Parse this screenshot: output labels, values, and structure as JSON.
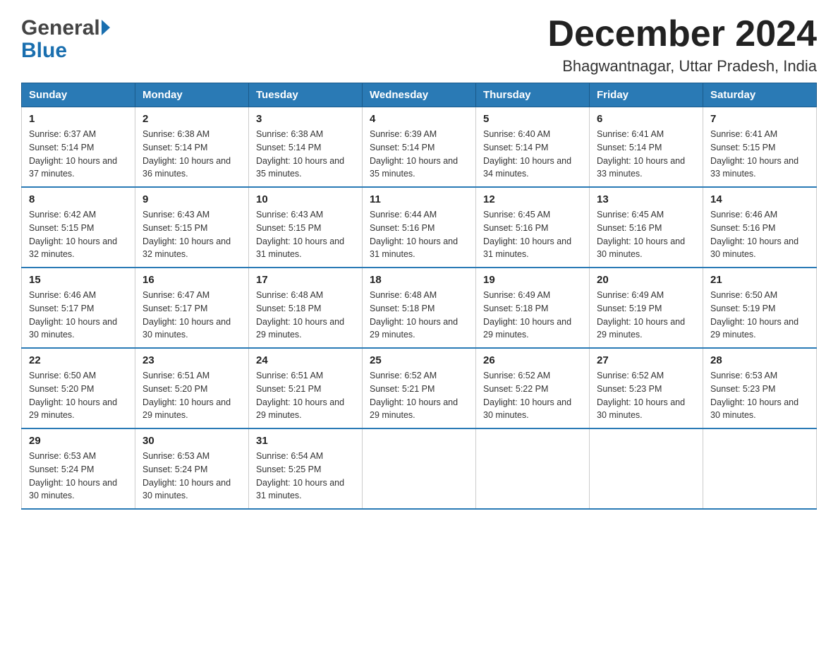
{
  "header": {
    "logo_general": "General",
    "logo_blue": "Blue",
    "month_title": "December 2024",
    "location": "Bhagwantnagar, Uttar Pradesh, India"
  },
  "days_of_week": [
    "Sunday",
    "Monday",
    "Tuesday",
    "Wednesday",
    "Thursday",
    "Friday",
    "Saturday"
  ],
  "weeks": [
    [
      {
        "day": "1",
        "sunrise": "6:37 AM",
        "sunset": "5:14 PM",
        "daylight": "10 hours and 37 minutes."
      },
      {
        "day": "2",
        "sunrise": "6:38 AM",
        "sunset": "5:14 PM",
        "daylight": "10 hours and 36 minutes."
      },
      {
        "day": "3",
        "sunrise": "6:38 AM",
        "sunset": "5:14 PM",
        "daylight": "10 hours and 35 minutes."
      },
      {
        "day": "4",
        "sunrise": "6:39 AM",
        "sunset": "5:14 PM",
        "daylight": "10 hours and 35 minutes."
      },
      {
        "day": "5",
        "sunrise": "6:40 AM",
        "sunset": "5:14 PM",
        "daylight": "10 hours and 34 minutes."
      },
      {
        "day": "6",
        "sunrise": "6:41 AM",
        "sunset": "5:14 PM",
        "daylight": "10 hours and 33 minutes."
      },
      {
        "day": "7",
        "sunrise": "6:41 AM",
        "sunset": "5:15 PM",
        "daylight": "10 hours and 33 minutes."
      }
    ],
    [
      {
        "day": "8",
        "sunrise": "6:42 AM",
        "sunset": "5:15 PM",
        "daylight": "10 hours and 32 minutes."
      },
      {
        "day": "9",
        "sunrise": "6:43 AM",
        "sunset": "5:15 PM",
        "daylight": "10 hours and 32 minutes."
      },
      {
        "day": "10",
        "sunrise": "6:43 AM",
        "sunset": "5:15 PM",
        "daylight": "10 hours and 31 minutes."
      },
      {
        "day": "11",
        "sunrise": "6:44 AM",
        "sunset": "5:16 PM",
        "daylight": "10 hours and 31 minutes."
      },
      {
        "day": "12",
        "sunrise": "6:45 AM",
        "sunset": "5:16 PM",
        "daylight": "10 hours and 31 minutes."
      },
      {
        "day": "13",
        "sunrise": "6:45 AM",
        "sunset": "5:16 PM",
        "daylight": "10 hours and 30 minutes."
      },
      {
        "day": "14",
        "sunrise": "6:46 AM",
        "sunset": "5:16 PM",
        "daylight": "10 hours and 30 minutes."
      }
    ],
    [
      {
        "day": "15",
        "sunrise": "6:46 AM",
        "sunset": "5:17 PM",
        "daylight": "10 hours and 30 minutes."
      },
      {
        "day": "16",
        "sunrise": "6:47 AM",
        "sunset": "5:17 PM",
        "daylight": "10 hours and 30 minutes."
      },
      {
        "day": "17",
        "sunrise": "6:48 AM",
        "sunset": "5:18 PM",
        "daylight": "10 hours and 29 minutes."
      },
      {
        "day": "18",
        "sunrise": "6:48 AM",
        "sunset": "5:18 PM",
        "daylight": "10 hours and 29 minutes."
      },
      {
        "day": "19",
        "sunrise": "6:49 AM",
        "sunset": "5:18 PM",
        "daylight": "10 hours and 29 minutes."
      },
      {
        "day": "20",
        "sunrise": "6:49 AM",
        "sunset": "5:19 PM",
        "daylight": "10 hours and 29 minutes."
      },
      {
        "day": "21",
        "sunrise": "6:50 AM",
        "sunset": "5:19 PM",
        "daylight": "10 hours and 29 minutes."
      }
    ],
    [
      {
        "day": "22",
        "sunrise": "6:50 AM",
        "sunset": "5:20 PM",
        "daylight": "10 hours and 29 minutes."
      },
      {
        "day": "23",
        "sunrise": "6:51 AM",
        "sunset": "5:20 PM",
        "daylight": "10 hours and 29 minutes."
      },
      {
        "day": "24",
        "sunrise": "6:51 AM",
        "sunset": "5:21 PM",
        "daylight": "10 hours and 29 minutes."
      },
      {
        "day": "25",
        "sunrise": "6:52 AM",
        "sunset": "5:21 PM",
        "daylight": "10 hours and 29 minutes."
      },
      {
        "day": "26",
        "sunrise": "6:52 AM",
        "sunset": "5:22 PM",
        "daylight": "10 hours and 30 minutes."
      },
      {
        "day": "27",
        "sunrise": "6:52 AM",
        "sunset": "5:23 PM",
        "daylight": "10 hours and 30 minutes."
      },
      {
        "day": "28",
        "sunrise": "6:53 AM",
        "sunset": "5:23 PM",
        "daylight": "10 hours and 30 minutes."
      }
    ],
    [
      {
        "day": "29",
        "sunrise": "6:53 AM",
        "sunset": "5:24 PM",
        "daylight": "10 hours and 30 minutes."
      },
      {
        "day": "30",
        "sunrise": "6:53 AM",
        "sunset": "5:24 PM",
        "daylight": "10 hours and 30 minutes."
      },
      {
        "day": "31",
        "sunrise": "6:54 AM",
        "sunset": "5:25 PM",
        "daylight": "10 hours and 31 minutes."
      },
      {
        "day": "",
        "sunrise": "",
        "sunset": "",
        "daylight": ""
      },
      {
        "day": "",
        "sunrise": "",
        "sunset": "",
        "daylight": ""
      },
      {
        "day": "",
        "sunrise": "",
        "sunset": "",
        "daylight": ""
      },
      {
        "day": "",
        "sunrise": "",
        "sunset": "",
        "daylight": ""
      }
    ]
  ]
}
